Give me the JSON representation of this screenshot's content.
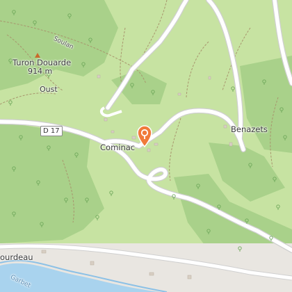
{
  "map": {
    "labels": {
      "peak_name": "Turon Douarde",
      "peak_elevation": "914 m",
      "soulan": "Soulan",
      "oust": "Oust",
      "road_ref": "D 17",
      "cominac": "Cominac",
      "benazets": "Benazets",
      "bourdeau": "ourdeau",
      "river": "Garbet"
    },
    "colors": {
      "meadow": "#c7e3a2",
      "forest": "#a9d18a",
      "road": "#ffffff",
      "road_casing": "#cfcfcf",
      "track": "#a8956d",
      "water": "#a9d3ee",
      "marker": "#f07a3a"
    },
    "icons": {
      "marker": "location-pin-icon",
      "peak": "peak-triangle-icon",
      "tree": "tree-icon"
    }
  }
}
